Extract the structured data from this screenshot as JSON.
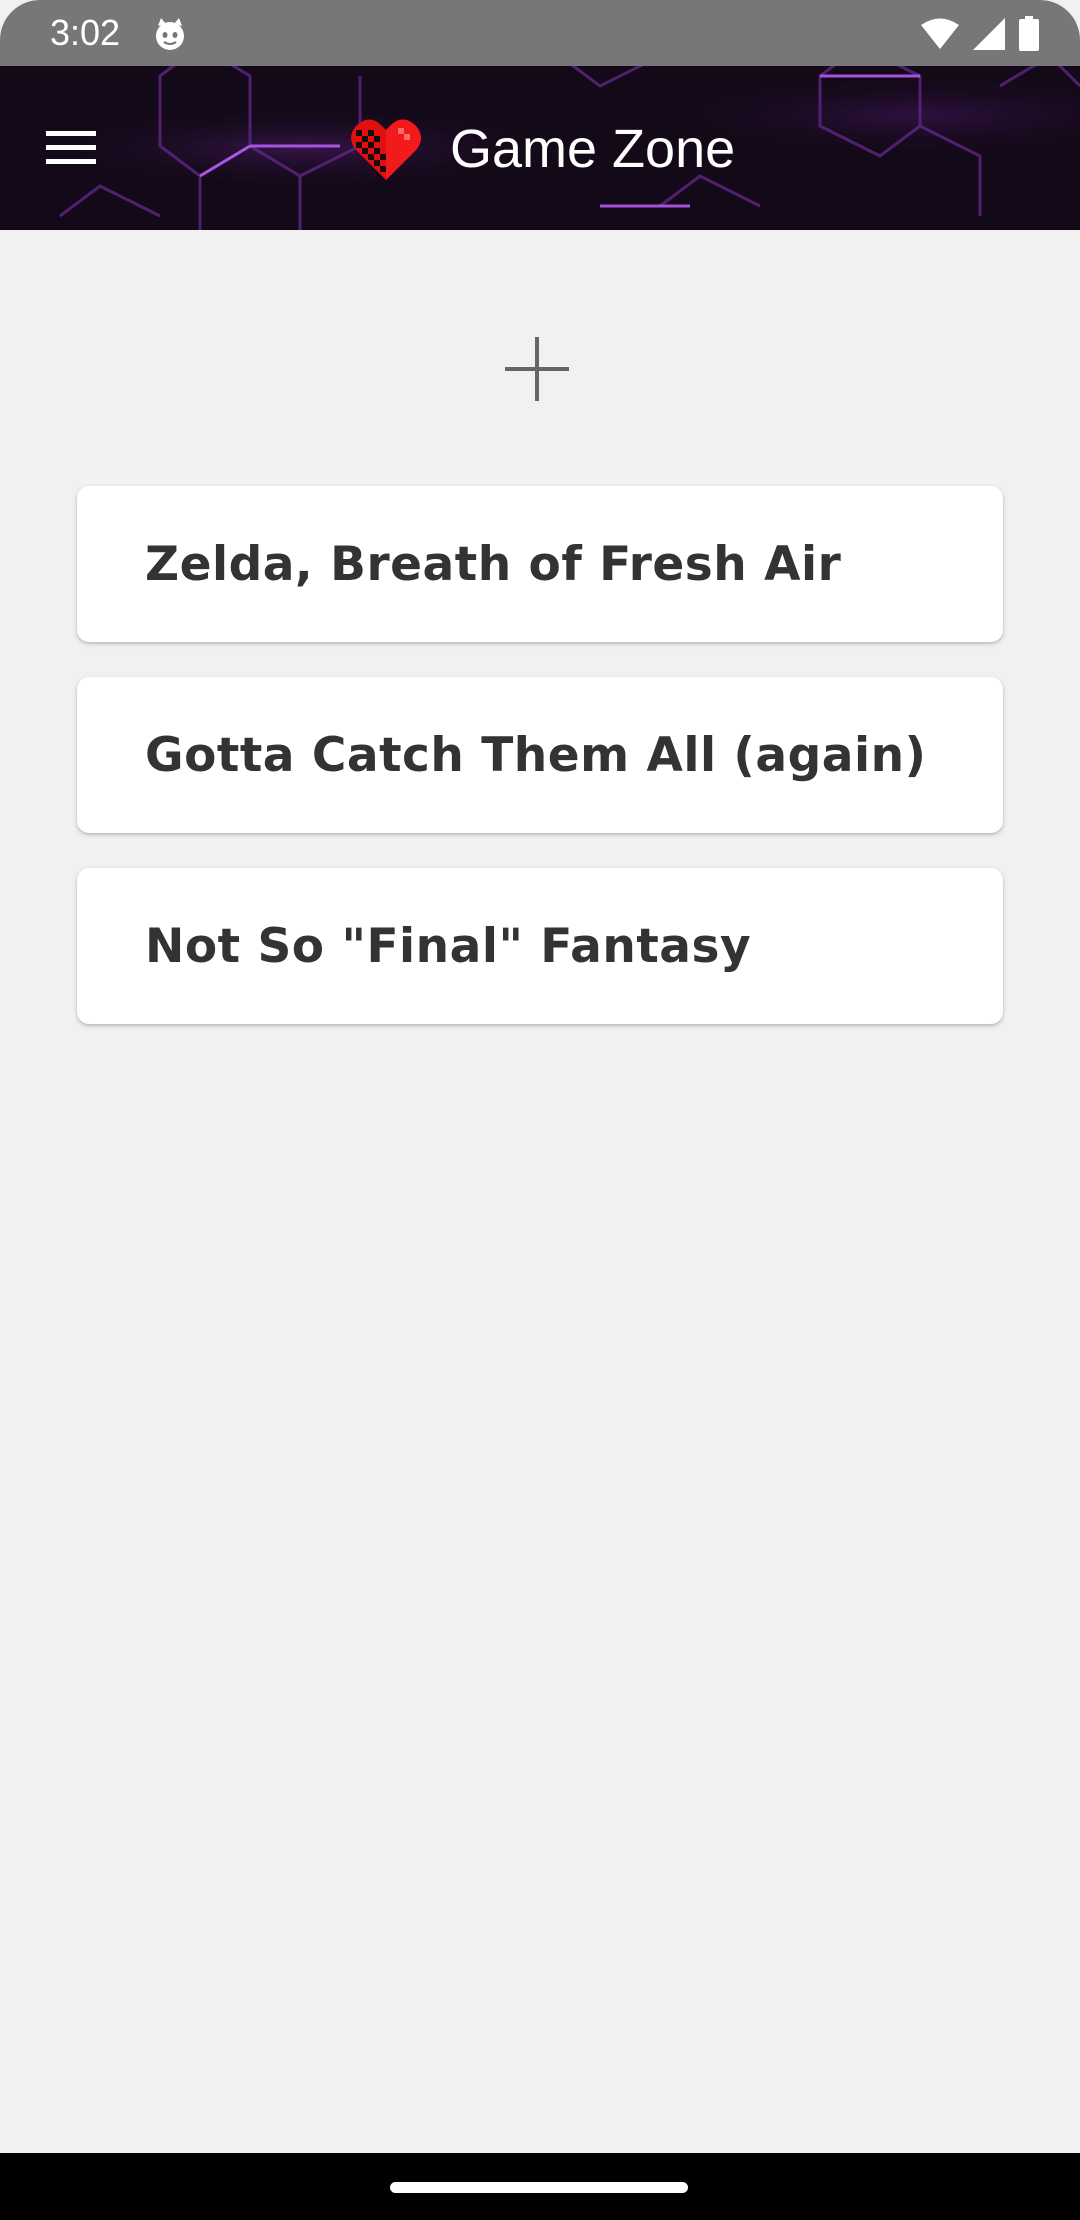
{
  "status_bar": {
    "time": "3:02",
    "icons": [
      "cat-face-icon",
      "wifi-icon",
      "signal-icon",
      "battery-icon"
    ]
  },
  "app_bar": {
    "title": "Game Zone",
    "menu_icon": "hamburger-menu-icon",
    "logo_icon": "pixel-heart-icon",
    "accent_color": "#a43fe0"
  },
  "main": {
    "add_icon": "plus-icon",
    "games": [
      {
        "title": "Zelda, Breath of Fresh Air"
      },
      {
        "title": "Gotta Catch Them All (again)"
      },
      {
        "title": "Not So \"Final\" Fantasy"
      }
    ]
  },
  "colors": {
    "background": "#f1f1f2",
    "card": "#ffffff",
    "card_text": "#333333",
    "status_bar": "#777777",
    "heart": "#e01010"
  }
}
